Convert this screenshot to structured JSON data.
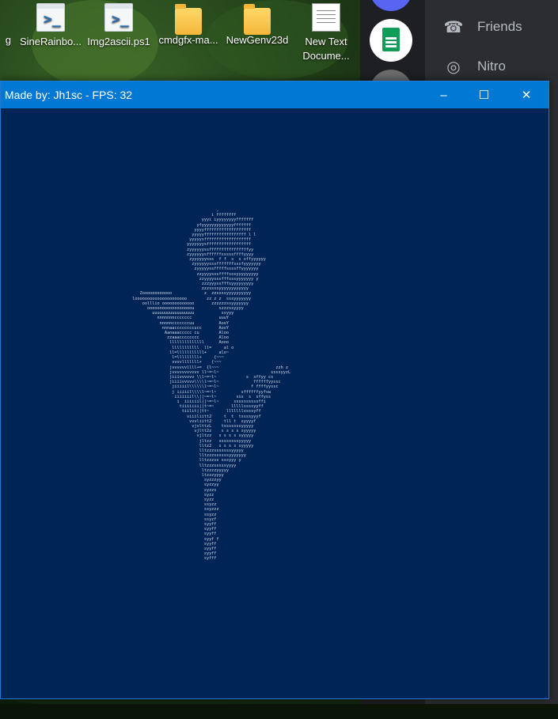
{
  "desktop": {
    "icons": [
      {
        "label": "g",
        "type": "partial"
      },
      {
        "label": "SineRainbo...",
        "type": "ps"
      },
      {
        "label": "Img2ascii.ps1",
        "type": "ps"
      },
      {
        "label": "cmdgfx-ma...",
        "type": "folder"
      },
      {
        "label": "NewGenv23d",
        "type": "folder"
      },
      {
        "label": "New Text Docume...",
        "type": "text"
      }
    ]
  },
  "discord": {
    "nav": [
      {
        "label": "Friends",
        "icon": "friends-icon"
      },
      {
        "label": "Nitro",
        "icon": "nitro-icon"
      }
    ]
  },
  "console_window": {
    "title": "Made by: Jh1sc - FPS: 32",
    "controls": {
      "minimize": "–",
      "maximize": "☐",
      "close": "✕"
    },
    "ascii_art": "                                    ,\n                                  i ffffffff\n                              yyyi iyyyyyyyyfffffff\n                            yfyyyyyyyyyyyyyfffffff\n                           yyyyfffffffffffffffffff\n                          yyyyyfffffffffffffffff l l\n                         yyyyysfffffffffffffffffff\n                        yyyyyyysffffffffffffffffff\n                        zyyyyyyssffffffffffffffffyy\n                        zyyyyyysffffffsssssffffyyyy\n                         zyyyyyysss  f f  s  s sffyyyyyy\n                          zyyyyyysssfffffffsssfyyyyyyy\n                           zyyyyyssfffffssssffyyyyyyy\n                            zzyyyysssffffsssyyyyyyyyy\n                             zzyyyysssfffsssyyyyyyy y\n                              zzzyyyssfffsyyyyyyyyy\n                              zzzssssyyyyyyyyyyyy\n     Zoooooooooooo             z  zzssssyyyyyyyyyy\n  looooooooooooooooooooo        zz z z  sssyyyyyyy\n      oolllio ooooooooooooo       zzzzzzssyyyyyyy\n        oooooooooooooooooou          szzzssyyyy\n          uuuuuuuuuuuuuuuuu           ssyyy\n            nnnnnnnccccccc           uuuY\n             nnnnncccccccuu          AooY\n              nnnaaccccccccucc       AooY\n               Aanaaaccccc cu        Aloo\n                zzaaacccccccc        Aloo\n                 llllllllllllll      Aooo\n                  lllllllllll  ll=     al o\n                 ll=lllllllllll+     alo~\n                  l=lllllllll+     {~~~\n                  vvvvlllllll+    {~~~\n                 jvvvvvvllll+=  {l~~~                       zzh z\n                 jvvvvvvvvvvv ll~=~l~                     ssssyyzL\n                 jiiivvvvvv \\\\l~=~l~            s  sffyy cs\n                 jiiiivvvvv\\\\\\\\l~=~l~              ffffffyyssc\n                  jiiiiil\\\\\\\\\\\\l~=~l~             f ffffyyssc\n                  j iiiiil\\\\\\\\l~=~l~          sffffffyyfsw\n                   iiiiiiil\\\\||~=~l~        sss  s  sffyss\n                    i  iiiiiil||~=~l~      ssssssssssffi\n                     tiiiiiii||t~=~       lllllssssyyff\n                      tiilit||tt~       lllllllssssyff\n                        viiiliitt2     t  t  tssssyyyf\n                         vvvliitt2     tll t  syyyyf\n                          vjvlttzL    tsssssssyyyyy\n                           vjltt2z    s s s s syyyyy\n                            vjltzz   s s s s syyyyy\n                             jltzz   ssssssssyyyyy\n                             lltz2   s s s s syyyyy\n                             lltzzzsssssssyyyyy\n                             lltzzzssssssyyyyyyy\n                             lltzzzss sssyyy y\n                             lltzzzsssssyyyy\n                              ltzzzzyyyyy\n                              ltzzzyyyy\n                               syzzzyy\n                               syzzyy\n                               syzzs\n                               syzz\n                               syzz\n                               ssyzz\n                               ssyzzz\n                               ssyzz\n                               ssyzf\n                               syyff\n                               syyff\n                               syyff\n                               syyf f\n                               syyff\n                               syyff\n                               syyff\n                               syfff"
  }
}
